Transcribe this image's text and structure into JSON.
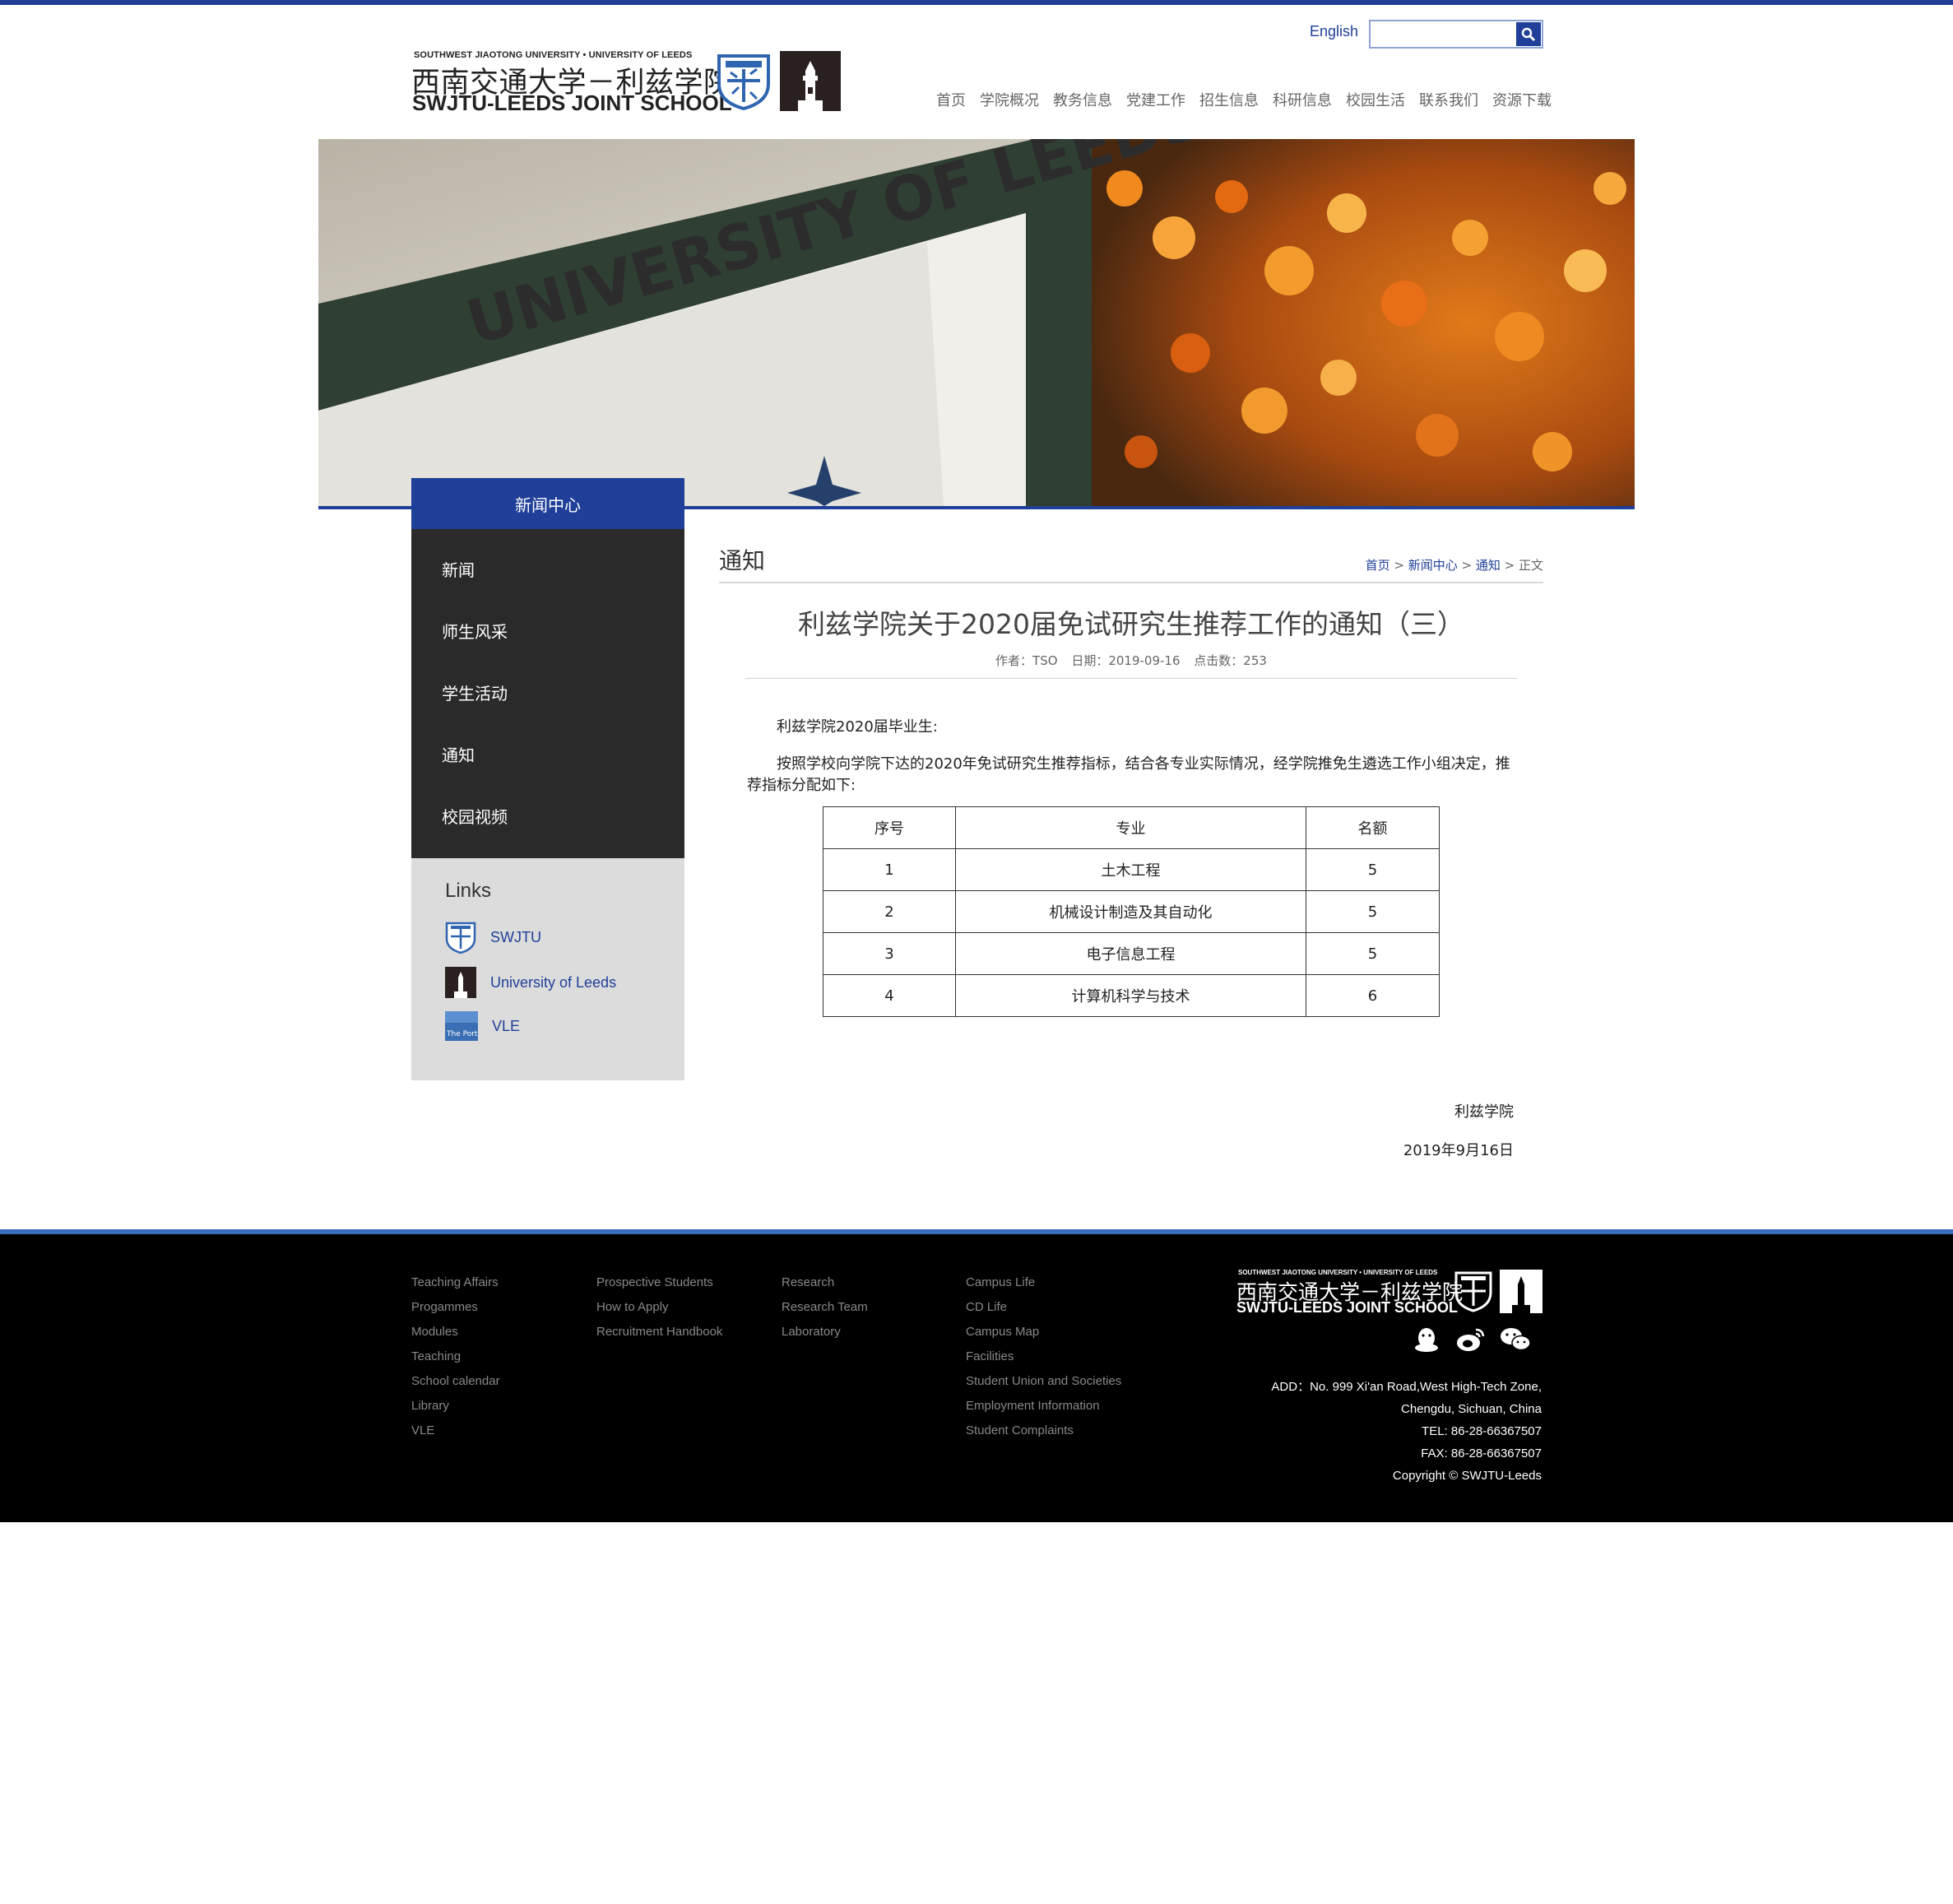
{
  "header": {
    "logo": {
      "tagline": "SOUTHWEST JIAOTONG UNIVERSITY • UNIVERSITY OF LEEDS",
      "name_cn": "西南交通大学－利兹学院",
      "name_en": "SWJTU-LEEDS JOINT SCHOOL"
    },
    "lang_link": "English",
    "search": {
      "value": "",
      "placeholder": ""
    },
    "nav": [
      "首页",
      "学院概况",
      "教务信息",
      "党建工作",
      "招生信息",
      "科研信息",
      "校园生活",
      "联系我们",
      "资源下载"
    ]
  },
  "banner": {
    "sign_text": "UNIVERSITY OF LEEDS"
  },
  "sidebar": {
    "title": "新闻中心",
    "items": [
      "新闻",
      "师生风采",
      "学生活动",
      "通知",
      "校园视频"
    ],
    "links_title": "Links",
    "links": [
      {
        "label": "SWJTU",
        "icon": "swjtu-seal-icon"
      },
      {
        "label": "University of Leeds",
        "icon": "leeds-tower-icon"
      },
      {
        "label": "VLE",
        "icon": "portal-icon",
        "icon_text": "The Portal"
      }
    ]
  },
  "content": {
    "section_title": "通知",
    "breadcrumb": {
      "home": "首页",
      "sep": " > ",
      "news": "新闻中心",
      "notice": "通知",
      "current": "正文"
    },
    "article": {
      "title": "利兹学院关于2020届免试研究生推荐工作的通知（三）",
      "author": "作者：TSO",
      "date": "日期：2019-09-16",
      "views": "点击数：253",
      "greeting": "利兹学院2020届毕业生:",
      "body": "按照学校向学院下达的2020年免试研究生推荐指标，结合各专业实际情况，经学院推免生遴选工作小组决定，推荐指标分配如下:",
      "table": {
        "headers": [
          "序号",
          "专业",
          "名额"
        ],
        "rows": [
          [
            "1",
            "土木工程",
            "5"
          ],
          [
            "2",
            "机械设计制造及其自动化",
            "5"
          ],
          [
            "3",
            "电子信息工程",
            "5"
          ],
          [
            "4",
            "计算机科学与技术",
            "6"
          ]
        ]
      },
      "signature": "利兹学院",
      "sign_date": "2019年9月16日"
    }
  },
  "footer": {
    "col1": [
      "Teaching Affairs",
      "Progammes",
      "Modules",
      "Teaching",
      "School calendar",
      "Library",
      "VLE"
    ],
    "col2": [
      "Prospective Students",
      "How to Apply",
      "Recruitment Handbook"
    ],
    "col3": [
      "Research",
      "Research Team",
      "Laboratory"
    ],
    "col4": [
      "Campus Life",
      "CD Life",
      "Campus Map",
      "Facilities",
      "Student Union and Societies",
      "Employment Information",
      "Student Complaints"
    ],
    "logo": {
      "tagline": "SOUTHWEST JIAOTONG UNIVERSITY • UNIVERSITY OF LEEDS",
      "name_cn": "西南交通大学－利兹学院",
      "name_en": "SWJTU-LEEDS JOINT SCHOOL"
    },
    "social": [
      "qq-icon",
      "weibo-icon",
      "wechat-icon"
    ],
    "address_line1": "ADD：No. 999 Xi'an Road,West High-Tech Zone,",
    "address_line2": "Chengdu, Sichuan, China",
    "tel": "TEL: 86-28-66367507",
    "fax": "FAX: 86-28-66367507",
    "copyright": "Copyright © SWJTU-Leeds"
  },
  "colors": {
    "brand_blue": "#1f3f99",
    "sidebar_dark": "#2a2a2a",
    "links_panel": "#dcdcdc",
    "footer_bg": "#000000"
  }
}
